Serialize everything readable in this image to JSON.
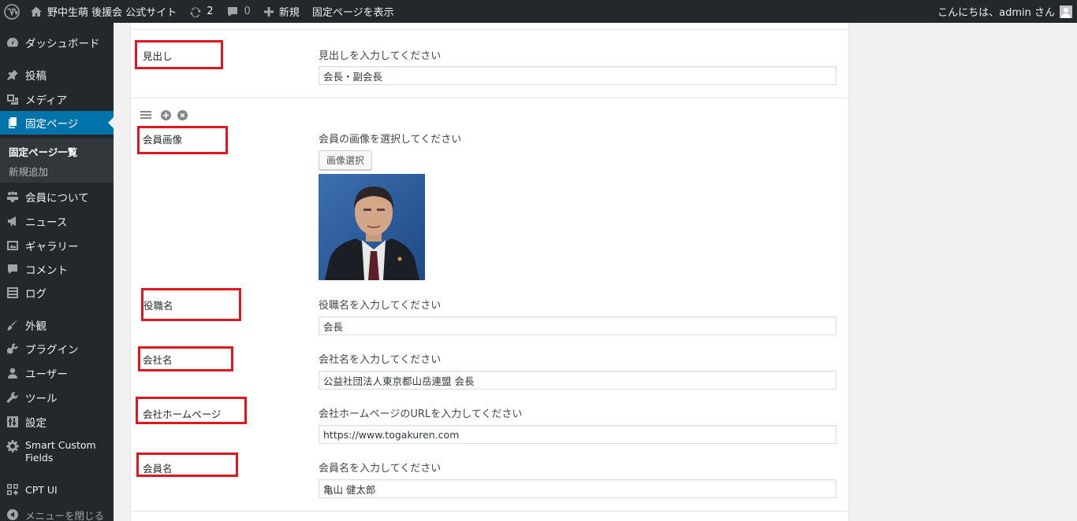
{
  "adminbar": {
    "site_name": "野中生萌 後援会 公式サイト",
    "updates_count": "2",
    "comments_count": "0",
    "new_label": "新規",
    "view_page_label": "固定ページを表示",
    "greeting": "こんにちは、admin さん"
  },
  "sidebar": {
    "items": [
      {
        "label": "ダッシュボード",
        "icon": "dashboard-icon"
      },
      {
        "label": "投稿",
        "icon": "pin-icon"
      },
      {
        "label": "メディア",
        "icon": "media-icon"
      },
      {
        "label": "固定ページ",
        "icon": "page-icon"
      },
      {
        "label": "会員について",
        "icon": "groups-icon"
      },
      {
        "label": "ニュース",
        "icon": "megaphone-icon"
      },
      {
        "label": "ギャラリー",
        "icon": "gallery-icon"
      },
      {
        "label": "コメント",
        "icon": "comment-icon"
      },
      {
        "label": "ログ",
        "icon": "list-icon"
      },
      {
        "label": "外観",
        "icon": "brush-icon"
      },
      {
        "label": "プラグイン",
        "icon": "plugin-icon"
      },
      {
        "label": "ユーザー",
        "icon": "user-icon"
      },
      {
        "label": "ツール",
        "icon": "wrench-icon"
      },
      {
        "label": "設定",
        "icon": "settings-icon"
      },
      {
        "label": "Smart Custom Fields",
        "icon": "gear-icon"
      },
      {
        "label": "CPT UI",
        "icon": "grid-icon"
      }
    ],
    "submenu": [
      "固定ページ一覧",
      "新規追加"
    ],
    "collapse_label": "メニューを閉じる"
  },
  "fields": {
    "heading": {
      "label": "見出し",
      "note": "見出しを入力してください",
      "value": "会長・副会長"
    },
    "image": {
      "label": "会員画像",
      "note": "会員の画像を選択してください",
      "button": "画像選択"
    },
    "position": {
      "label": "役職名",
      "note": "役職名を入力してください",
      "value": "会長"
    },
    "company": {
      "label": "会社名",
      "note": "会社名を入力してください",
      "value": "公益社団法人東京都山岳連盟 会長"
    },
    "homepage": {
      "label": "会社ホームページ",
      "note": "会社ホームページのURLを入力してください",
      "value": "https://www.togakuren.com"
    },
    "member": {
      "label": "会員名",
      "note": "会員名を入力してください",
      "value": "亀山 健太郎"
    }
  },
  "colors": {
    "adminbar_bg": "#23282d",
    "menu_current": "#0073aa",
    "highlight_box": "#e3151e"
  }
}
